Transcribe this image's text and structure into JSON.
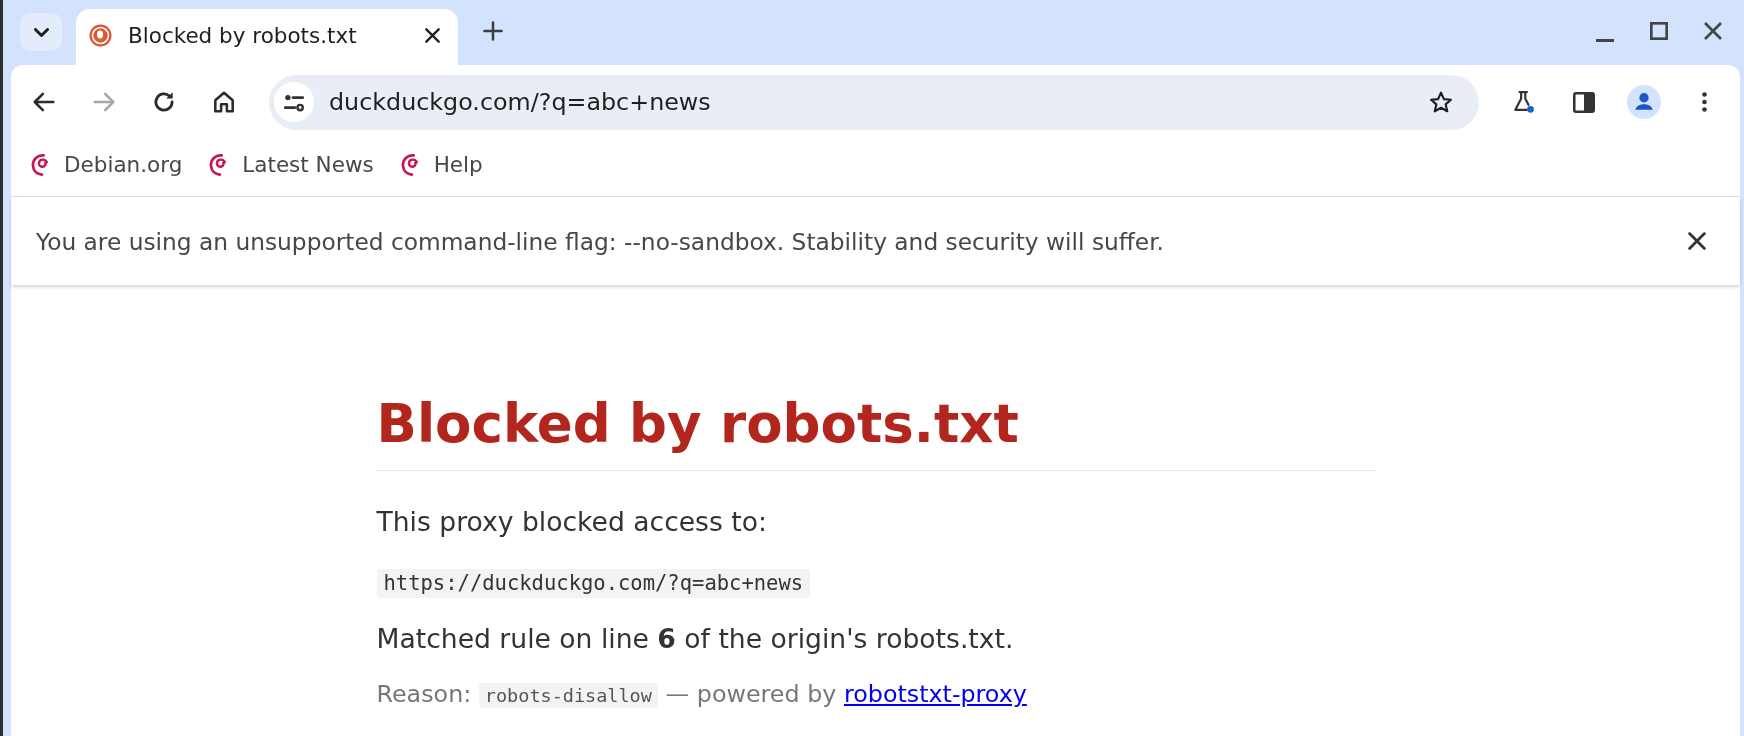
{
  "tabs": [
    {
      "title": "Blocked by robots.txt",
      "selected": true
    }
  ],
  "toolbar": {
    "nav_buttons": [
      {
        "kind": "back",
        "disabled": false
      },
      {
        "kind": "forward",
        "disabled": true
      },
      {
        "kind": "reload",
        "disabled": false
      },
      {
        "kind": "home",
        "disabled": false
      }
    ],
    "url": "duckduckgo.com/?q=abc+news"
  },
  "bookmarks": [
    {
      "label": "Debian.org"
    },
    {
      "label": "Latest News"
    },
    {
      "label": "Help"
    }
  ],
  "infobar": {
    "message": "You are using an unsupported command-line flag: --no-sandbox. Stability and security will suffer."
  },
  "page": {
    "heading": "Blocked by robots.txt",
    "intro": "This proxy blocked access to:",
    "blocked_url": "https://duckduckgo.com/?q=abc+news",
    "matched_rule": "Matched rule on line **6** of the origin's robots.txt.",
    "reason_label": "Reason:",
    "reason_code": "robots-disallow",
    "powered_by": "— powered by",
    "link": "robotstxt-proxy"
  }
}
